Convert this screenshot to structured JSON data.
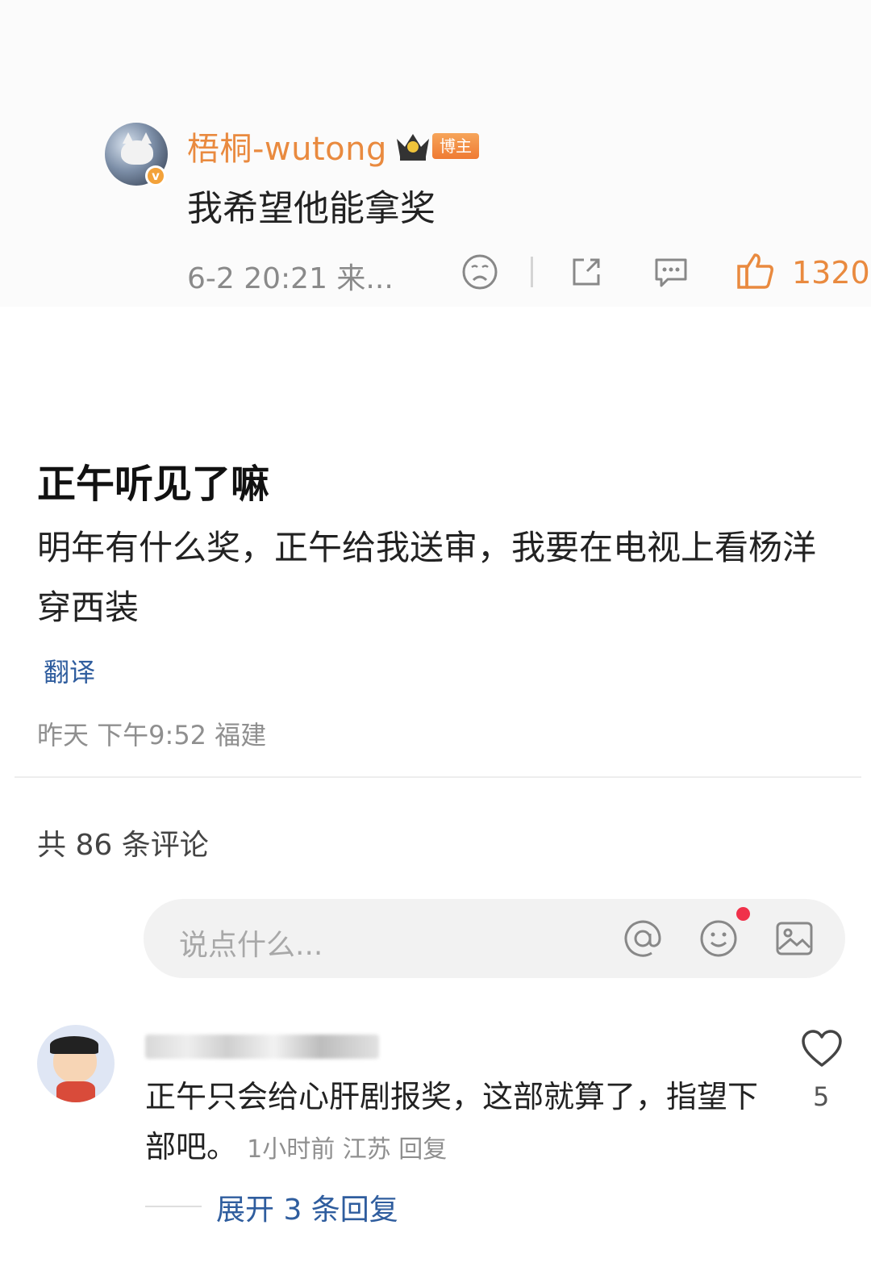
{
  "top_comment": {
    "username": "梧桐-wutong",
    "role_badge": "博主",
    "text": "我希望他能拿奖",
    "meta": "6-2 20:21  来...",
    "likes": "1320",
    "icons": [
      "crown-icon",
      "verified-icon",
      "sad-face-icon",
      "share-icon",
      "comment-icon",
      "thumbs-up-icon"
    ]
  },
  "main": {
    "title": "正午听见了嘛",
    "body": "明年有什么奖，正午给我送审，我要在电视上看杨洋穿西装",
    "translate_label": "翻译",
    "meta": "昨天 下午9:52 福建"
  },
  "comments": {
    "count_label": "共 86 条评论",
    "input_placeholder": "说点什么...",
    "input_icons": [
      "at-icon",
      "emoji-icon",
      "image-icon"
    ]
  },
  "reply": {
    "text": "正午只会给心肝剧报奖，这部就算了，指望下部吧。",
    "meta": "1小时前 江苏 回复",
    "likes": "5",
    "expand_label": "展开 3 条回复"
  },
  "colors": {
    "accent_orange": "#e98a3f",
    "link_blue": "#2f5d9e",
    "notification_red": "#f0314a"
  }
}
